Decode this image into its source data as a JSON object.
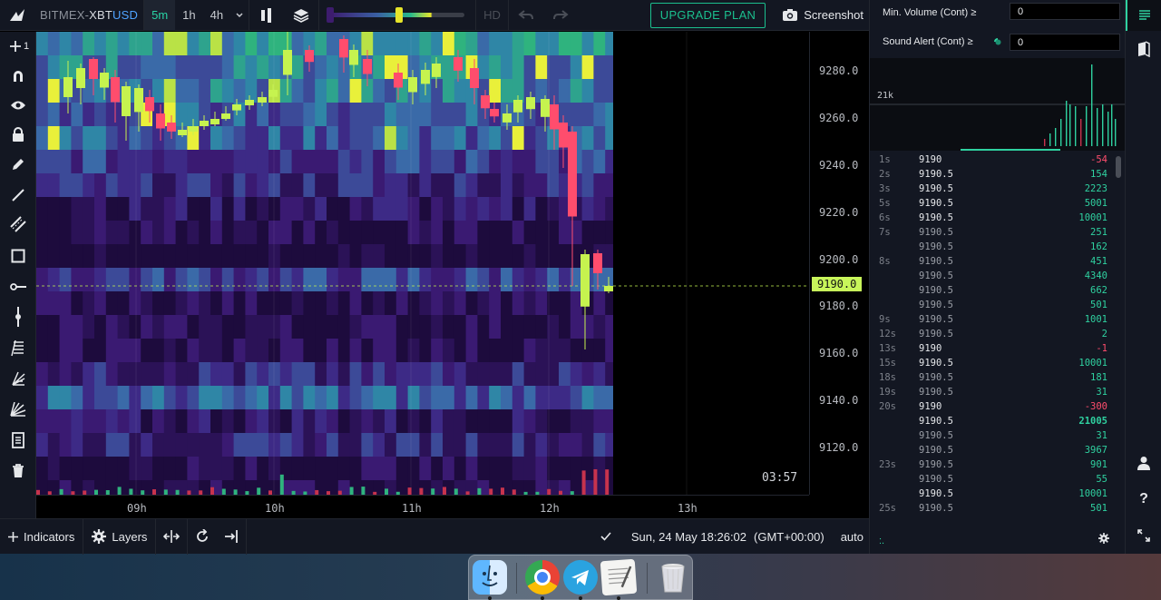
{
  "window": {
    "symbol_exchange": "BITMEX",
    "symbol_separator": "-",
    "symbol_base": "XBT",
    "symbol_quote": "USD"
  },
  "toolbar": {
    "timeframes": [
      "5m",
      "1h",
      "4h"
    ],
    "active_timeframe": "5m",
    "hd_label": "HD",
    "upgrade_label": "UPGRADE PLAN",
    "screenshot_label": "Screenshot",
    "heatmap_slider": {
      "low_fraction": 0.0,
      "high_fraction": 0.51
    }
  },
  "left_tools": {
    "zoom_label": "1",
    "icons": [
      "crosshair-plus-icon",
      "magnet-icon",
      "eye-icon",
      "lock-icon",
      "pencil-icon",
      "trend-line-icon",
      "parallel-channel-icon",
      "rectangle-icon",
      "horizontal-ray-icon",
      "vertical-line-icon",
      "fib-retracement-icon",
      "fib-fan-icon",
      "gann-fan-icon",
      "notes-icon",
      "trash-icon"
    ]
  },
  "chart": {
    "price_ticks": [
      "9280.0",
      "9260.0",
      "9240.0",
      "9220.0",
      "9200.0",
      "9180.0",
      "9160.0",
      "9140.0",
      "9120.0"
    ],
    "time_ticks": [
      "09h",
      "10h",
      "11h",
      "12h",
      "13h"
    ],
    "last_price": "9190.0",
    "countdown": "03:57",
    "colors": {
      "bid_candle": "#c6f34f",
      "ask_candle": "#ff4d6d",
      "heat_low": "#2b1257",
      "heat_mid": "#3a6aa8",
      "heat_high": "#2fb37e",
      "heat_max": "#e9f03a"
    }
  },
  "bottom": {
    "indicators_label": "Indicators",
    "layers_label": "Layers",
    "datetime": "Sun, 24 May 18:26:02",
    "timezone": "(GMT+00:00)",
    "scale_mode": "auto"
  },
  "panel": {
    "min_volume_label": "Min. Volume (Cont) ≥",
    "min_volume_value": "0",
    "sound_alert_label": "Sound Alert (Cont) ≥",
    "sound_alert_value": "0",
    "histogram_label": "21k",
    "footer_mark": ":.",
    "tape": [
      {
        "time": "1s",
        "price": "9190",
        "size": "-54",
        "side": "sell"
      },
      {
        "time": "2s",
        "price": "9190.5",
        "size": "154",
        "side": "buy"
      },
      {
        "time": "3s",
        "price": "9190.5",
        "size": "2223",
        "side": "buy"
      },
      {
        "time": "5s",
        "price": "9190.5",
        "size": "5001",
        "side": "buy"
      },
      {
        "time": "6s",
        "price": "9190.5",
        "size": "10001",
        "side": "buy"
      },
      {
        "time": "7s",
        "price": "9190.5",
        "size": "251",
        "side": "buy"
      },
      {
        "time": "",
        "price": "9190.5",
        "size": "162",
        "side": "buy"
      },
      {
        "time": "8s",
        "price": "9190.5",
        "size": "451",
        "side": "buy"
      },
      {
        "time": "",
        "price": "9190.5",
        "size": "4340",
        "side": "buy"
      },
      {
        "time": "",
        "price": "9190.5",
        "size": "662",
        "side": "buy"
      },
      {
        "time": "",
        "price": "9190.5",
        "size": "501",
        "side": "buy"
      },
      {
        "time": "9s",
        "price": "9190.5",
        "size": "1001",
        "side": "buy"
      },
      {
        "time": "12s",
        "price": "9190.5",
        "size": "2",
        "side": "buy"
      },
      {
        "time": "13s",
        "price": "9190",
        "size": "-1",
        "side": "sell"
      },
      {
        "time": "15s",
        "price": "9190.5",
        "size": "10001",
        "side": "buy"
      },
      {
        "time": "18s",
        "price": "9190.5",
        "size": "181",
        "side": "buy"
      },
      {
        "time": "19s",
        "price": "9190.5",
        "size": "31",
        "side": "buy"
      },
      {
        "time": "20s",
        "price": "9190",
        "size": "-300",
        "side": "sell"
      },
      {
        "time": "",
        "price": "9190.5",
        "size": "21005",
        "side": "buy"
      },
      {
        "time": "",
        "price": "9190.5",
        "size": "31",
        "side": "buy"
      },
      {
        "time": "",
        "price": "9190.5",
        "size": "3967",
        "side": "buy"
      },
      {
        "time": "23s",
        "price": "9190.5",
        "size": "901",
        "side": "buy"
      },
      {
        "time": "",
        "price": "9190.5",
        "size": "55",
        "side": "buy"
      },
      {
        "time": "",
        "price": "9190.5",
        "size": "10001",
        "side": "buy"
      },
      {
        "time": "25s",
        "price": "9190.5",
        "size": "501",
        "side": "buy"
      }
    ],
    "colors": {
      "buy": "#2fd1a0",
      "sell": "#ff4d6d"
    }
  },
  "right_sidebar": {
    "icons": [
      "order-book-icon",
      "book-icon",
      "user-icon",
      "help-icon",
      "fullscreen-icon"
    ],
    "help_label": "?"
  },
  "dock": {
    "apps": [
      "finder-icon",
      "chrome-icon",
      "telegram-icon",
      "textedit-icon",
      "trash-bin-icon"
    ]
  }
}
